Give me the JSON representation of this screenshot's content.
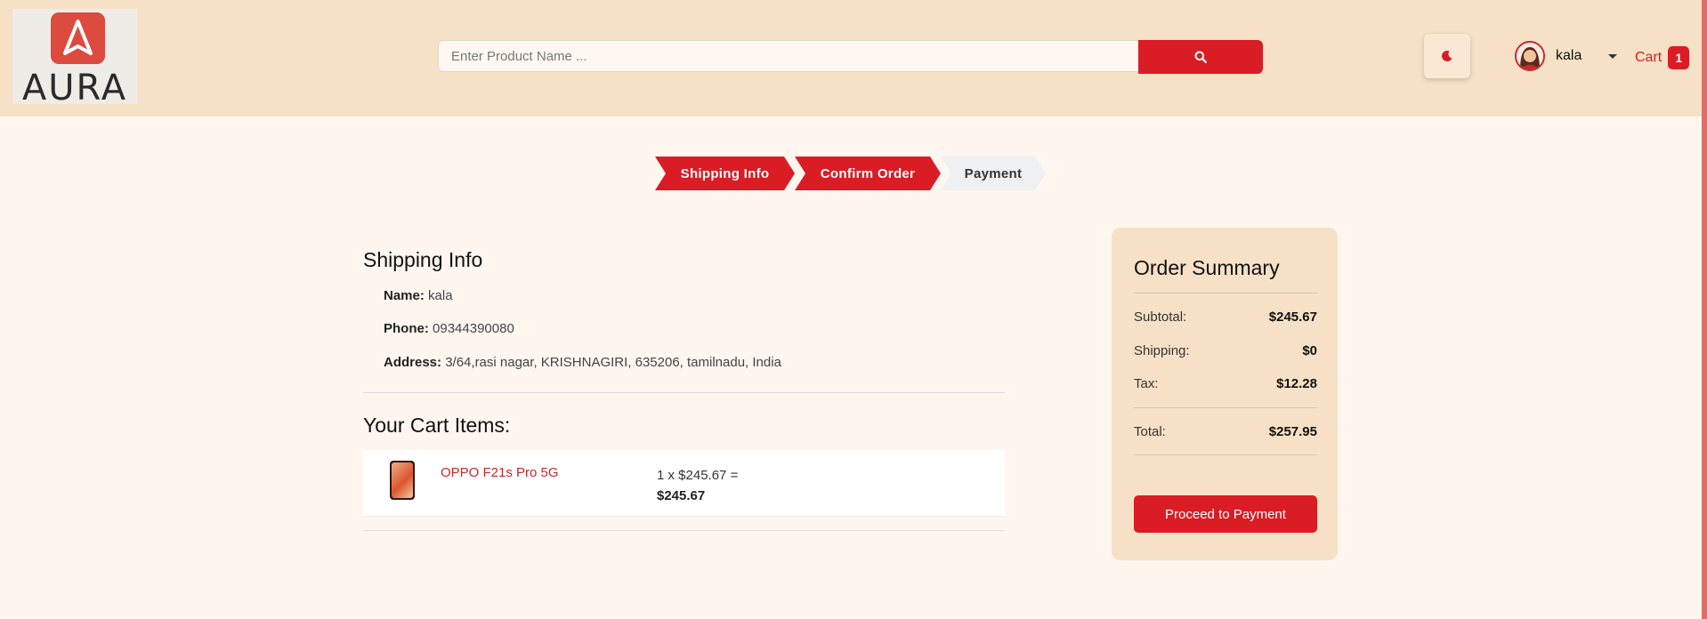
{
  "header": {
    "logo_text": "AURA",
    "search_placeholder": "Enter Product Name ...",
    "user_name": "kala",
    "cart_label": "Cart",
    "cart_count": "1"
  },
  "steps": [
    {
      "label": "Shipping Info",
      "active": true
    },
    {
      "label": "Confirm Order",
      "active": true
    },
    {
      "label": "Payment",
      "active": false
    }
  ],
  "shipping": {
    "title": "Shipping Info",
    "name_label": "Name:",
    "name_value": "kala",
    "phone_label": "Phone:",
    "phone_value": "09344390080",
    "address_label": "Address:",
    "address_value": "3/64,rasi nagar, KRISHNAGIRI, 635206, tamilnadu, India"
  },
  "cart": {
    "title": "Your Cart Items:",
    "items": [
      {
        "name": "OPPO F21s Pro 5G",
        "qty_price": "1 x $245.67 =",
        "total": "$245.67"
      }
    ]
  },
  "summary": {
    "title": "Order Summary",
    "subtotal_label": "Subtotal:",
    "subtotal_value": "$245.67",
    "shipping_label": "Shipping:",
    "shipping_value": "$0",
    "tax_label": "Tax:",
    "tax_value": "$12.28",
    "total_label": "Total:",
    "total_value": "$257.95",
    "button_label": "Proceed to Payment"
  },
  "colors": {
    "accent": "#da1c24",
    "header_bg": "#f6e1c6",
    "page_bg": "#fff6f0"
  },
  "icons": {
    "search": "search-icon",
    "theme": "moon-icon",
    "dropdown": "chevron-down-icon"
  }
}
